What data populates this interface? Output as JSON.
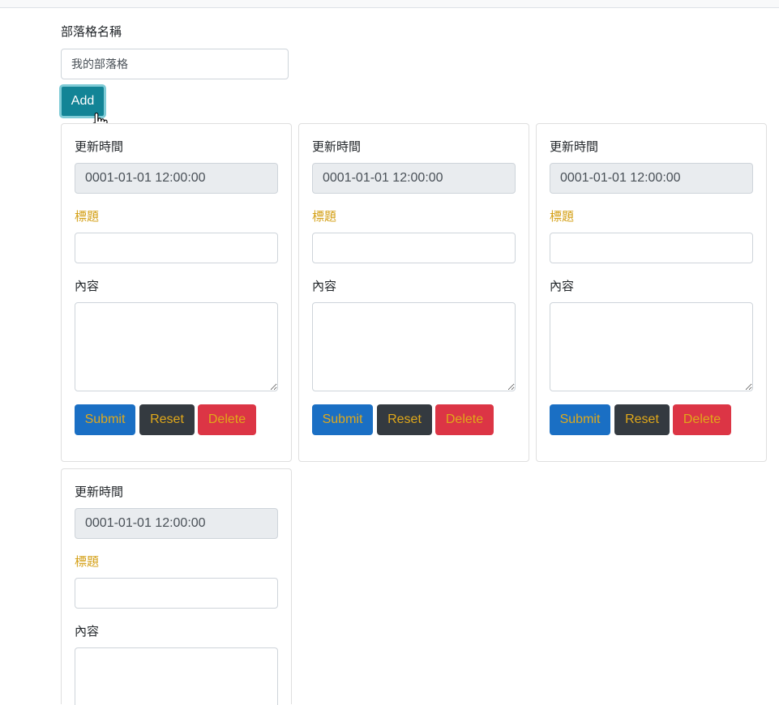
{
  "form": {
    "blog_name_label": "部落格名稱",
    "blog_name_value": "我的部落格",
    "add_label": "Add"
  },
  "cards": [
    {
      "updated_label": "更新時間",
      "updated_value": "0001-01-01 12:00:00",
      "title_label": "標題",
      "title_value": "",
      "content_label": "內容",
      "content_value": "",
      "submit_label": "Submit",
      "reset_label": "Reset",
      "delete_label": "Delete"
    },
    {
      "updated_label": "更新時間",
      "updated_value": "0001-01-01 12:00:00",
      "title_label": "標題",
      "title_value": "",
      "content_label": "內容",
      "content_value": "",
      "submit_label": "Submit",
      "reset_label": "Reset",
      "delete_label": "Delete"
    },
    {
      "updated_label": "更新時間",
      "updated_value": "0001-01-01 12:00:00",
      "title_label": "標題",
      "title_value": "",
      "content_label": "內容",
      "content_value": "",
      "submit_label": "Submit",
      "reset_label": "Reset",
      "delete_label": "Delete"
    },
    {
      "updated_label": "更新時間",
      "updated_value": "0001-01-01 12:00:00",
      "title_label": "標題",
      "title_value": "",
      "content_label": "內容",
      "content_value": ""
    }
  ],
  "colors": {
    "add_button": "#138496",
    "submit_button": "#1a6fc4",
    "reset_button": "#343a40",
    "delete_button": "#dc3545",
    "button_text": "#e0a81a",
    "title_label": "#d4a017"
  }
}
